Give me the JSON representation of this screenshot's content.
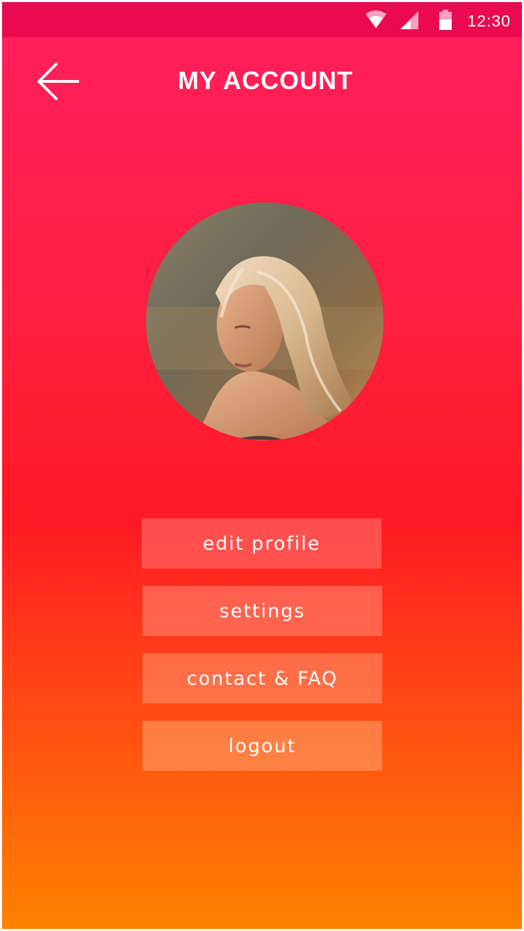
{
  "status_bar": {
    "time": "12:30",
    "icons": [
      "wifi-icon",
      "signal-icon",
      "battery-icon"
    ]
  },
  "header": {
    "back_icon": "arrow-left-icon",
    "title": "MY ACCOUNT"
  },
  "profile": {
    "avatar": "user-photo"
  },
  "menu": {
    "edit_profile": "edit profile",
    "settings": "settings",
    "contact_faq": "contact & FAQ",
    "logout": "logout"
  },
  "colors": {
    "status_bar": "#e90a4f",
    "gradient_top": "#ff1f5e",
    "gradient_middle": "#ff1a24",
    "gradient_bottom": "#ff8200",
    "text": "#ffffff"
  }
}
